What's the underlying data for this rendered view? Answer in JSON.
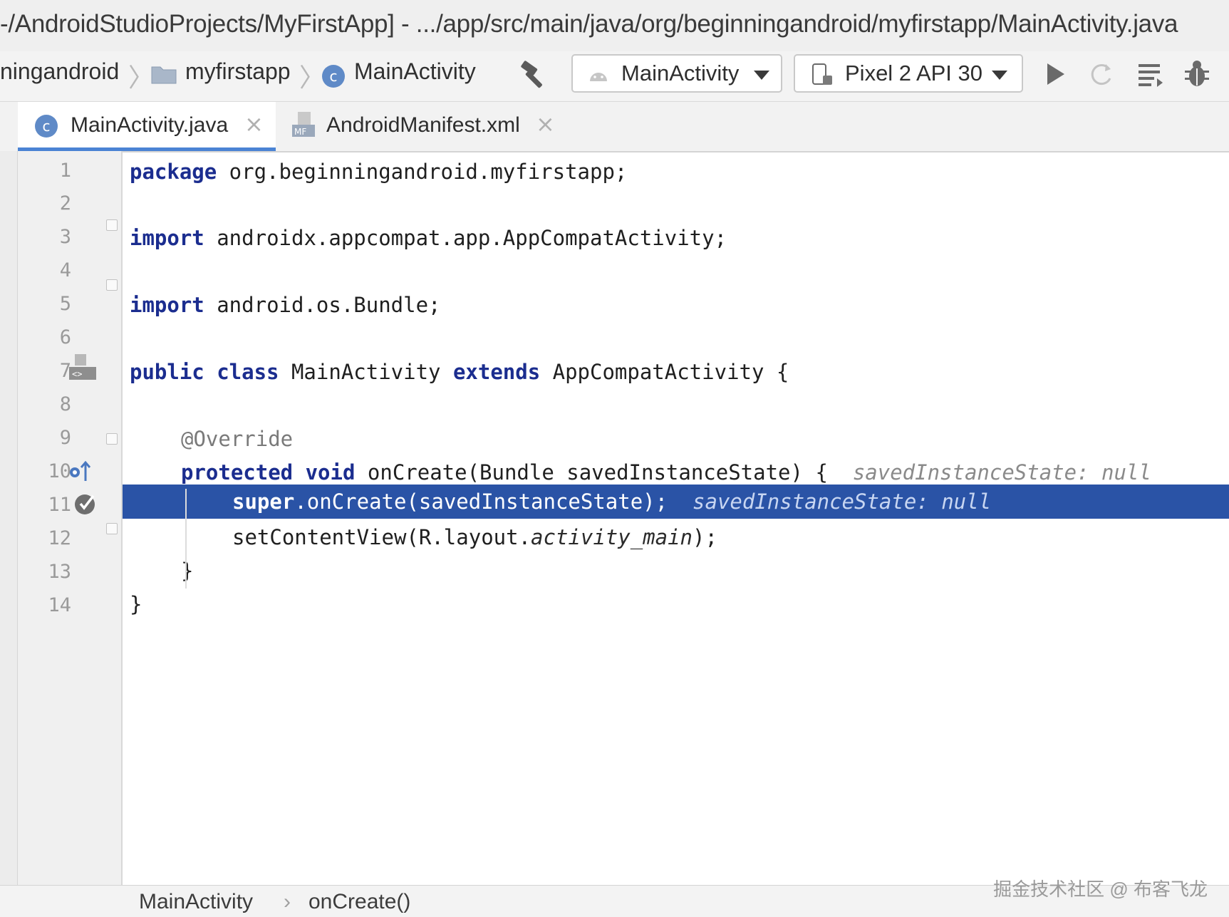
{
  "window": {
    "title": "-/AndroidStudioProjects/MyFirstApp] - .../app/src/main/java/org/beginningandroid/myfirstapp/MainActivity.java"
  },
  "navbar": {
    "crumbs": [
      "ningandroid",
      "myfirstapp",
      "MainActivity"
    ],
    "run_config": "MainActivity",
    "device": "Pixel 2 API 30"
  },
  "tabs": [
    {
      "label": "MainActivity.java",
      "icon": "class-icon",
      "active": true
    },
    {
      "label": "AndroidManifest.xml",
      "icon": "manifest-icon",
      "active": false
    }
  ],
  "editor": {
    "line_numbers": [
      "1",
      "2",
      "3",
      "4",
      "5",
      "6",
      "7",
      "8",
      "9",
      "10",
      "11",
      "12",
      "13",
      "14"
    ],
    "current_line": 11,
    "code": {
      "l1_kw": "package",
      "l1_rest": " org.beginningandroid.myfirstapp;",
      "l3_kw": "import",
      "l3_rest": " androidx.appcompat.app.AppCompatActivity;",
      "l5_kw": "import",
      "l5_rest": " android.os.Bundle;",
      "l7_kw1": "public class",
      "l7_mid": " MainActivity ",
      "l7_kw2": "extends",
      "l7_rest": " AppCompatActivity {",
      "l9": "@Override",
      "l10_kw": "protected void",
      "l10_rest": " onCreate(Bundle savedInstanceState) {",
      "l10_hint": "savedInstanceState: null",
      "l11_kw": "super",
      "l11_rest": ".onCreate(savedInstanceState);",
      "l11_hint": "savedInstanceState: null",
      "l12_a": "setContentView(R.layout.",
      "l12_it": "activity_main",
      "l12_b": ");",
      "l13": "}",
      "l14": "}"
    }
  },
  "bottom_breadcrumb": [
    "MainActivity",
    "onCreate()"
  ],
  "watermark": "掘金技术社区 @ 布客飞龙",
  "colors": {
    "keyword": "#1b2d8f",
    "highlight": "#2a53a6",
    "tab_underline": "#4a83d4"
  }
}
